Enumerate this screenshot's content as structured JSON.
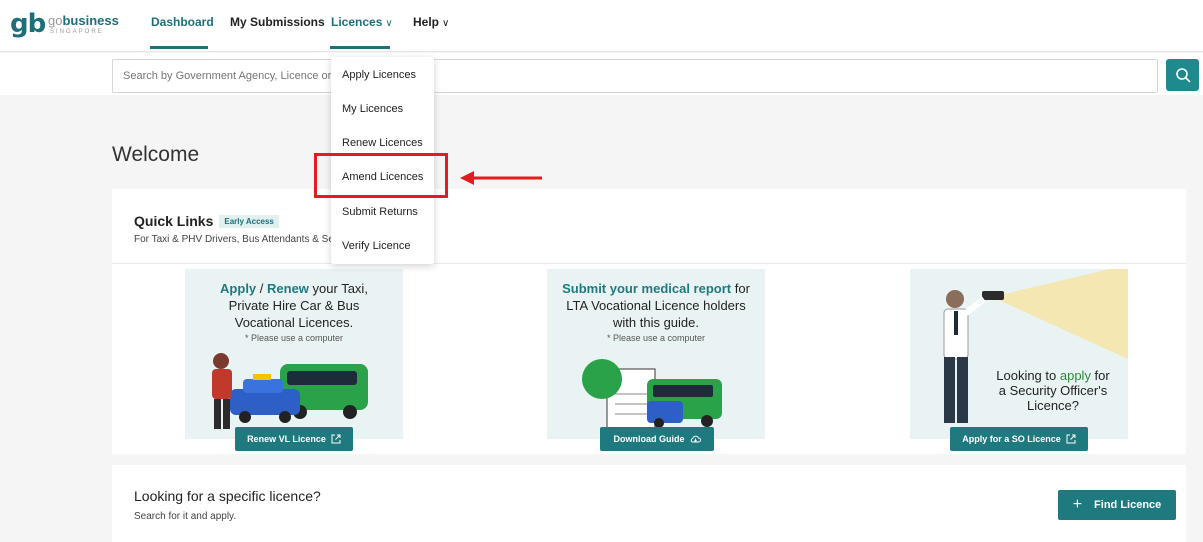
{
  "header": {
    "logo": {
      "mark": "gb",
      "go": "go",
      "business": "business",
      "country": "SINGAPORE"
    },
    "nav": [
      {
        "label": "Dashboard",
        "active": true
      },
      {
        "label": "My Submissions",
        "active": false
      },
      {
        "label": "Licences",
        "active": false,
        "has_caret": true
      },
      {
        "label": "Help",
        "active": false,
        "has_caret": true
      }
    ],
    "caret": "∨"
  },
  "search": {
    "placeholder": "Search by Government Agency, Licence or Licence Number"
  },
  "welcome": "Welcome",
  "quick_links": {
    "title": "Quick Links",
    "badge": "Early Access",
    "subtitle": "For Taxi & PHV Drivers, Bus Attendants & Security Officers"
  },
  "cards": [
    {
      "line1_hl1": "Apply",
      "line1_sep": " / ",
      "line1_hl2": "Renew",
      "line1_rest": " your Taxi,",
      "line2": "Private Hire Car & Bus",
      "line3": "Vocational Licences.",
      "note": "* Please use a computer",
      "button": "Renew VL Licence"
    },
    {
      "line1_hl": "Submit your medical report",
      "line1_rest": " for",
      "line2": "LTA Vocational Licence holders",
      "line3": "with this guide.",
      "note": "* Please use a computer",
      "button": "Download Guide"
    },
    {
      "line1_pre": "Looking to ",
      "line1_hl": "apply",
      "line1_rest": " for",
      "line2": "a Security Officer's",
      "line3": "Licence?",
      "button": "Apply for a SO Licence"
    }
  ],
  "find": {
    "title": "Looking for a specific licence?",
    "subtitle": "Search for it and apply.",
    "button": "Find Licence",
    "button_icon": "+"
  },
  "dropdown": {
    "items": [
      "Apply Licences",
      "My Licences",
      "Renew Licences",
      "Amend Licences",
      "Submit Returns",
      "Verify Licence"
    ],
    "highlighted": "Amend Licences"
  },
  "colors": {
    "brand": "#1f7a80",
    "highlight": "#e11d1d",
    "accent_green": "#2f8a3a"
  }
}
